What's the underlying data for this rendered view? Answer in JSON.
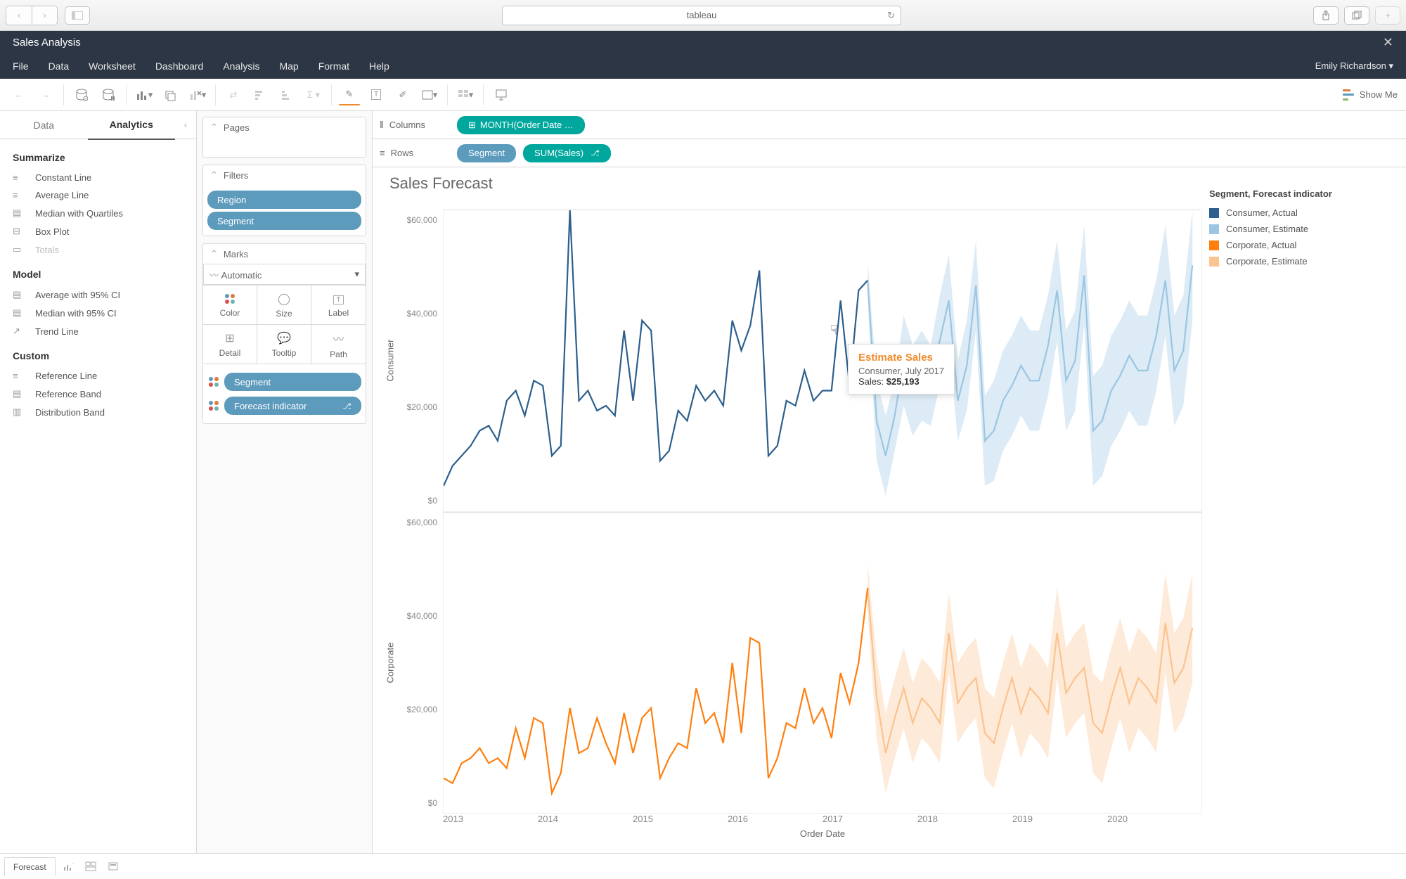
{
  "chrome": {
    "url": "tableau"
  },
  "header": {
    "title": "Sales Analysis",
    "menu": [
      "File",
      "Data",
      "Worksheet",
      "Dashboard",
      "Analysis",
      "Map",
      "Format",
      "Help"
    ],
    "user": "Emily Richardson ▾"
  },
  "toolbar": {
    "showme": "Show Me"
  },
  "left": {
    "tabs": [
      "Data",
      "Analytics"
    ],
    "summarize_h": "Summarize",
    "summarize": [
      "Constant Line",
      "Average Line",
      "Median with Quartiles",
      "Box Plot",
      "Totals"
    ],
    "model_h": "Model",
    "model": [
      "Average with 95% CI",
      "Median with 95% CI",
      "Trend Line"
    ],
    "custom_h": "Custom",
    "custom": [
      "Reference Line",
      "Reference Band",
      "Distribution Band"
    ]
  },
  "cards": {
    "pages": "Pages",
    "filters": "Filters",
    "filter_pills": [
      "Region",
      "Segment"
    ],
    "marks": "Marks",
    "mark_type": "Automatic",
    "mark_cells": [
      "Color",
      "Size",
      "Label",
      "Detail",
      "Tooltip",
      "Path"
    ],
    "mark_pills": [
      "Segment",
      "Forecast indicator"
    ]
  },
  "shelves": {
    "columns_lbl": "Columns",
    "columns_pill": "MONTH(Order Date …",
    "rows_lbl": "Rows",
    "rows_pills": [
      "Segment",
      "SUM(Sales)"
    ]
  },
  "viz": {
    "title": "Sales Forecast",
    "rows": [
      "Consumer",
      "Corporate"
    ],
    "yticks": [
      "$60,000",
      "$40,000",
      "$20,000",
      "$0"
    ],
    "xticks": [
      "2013",
      "2014",
      "2015",
      "2016",
      "2017",
      "2018",
      "2019",
      "2020"
    ],
    "xlabel": "Order Date",
    "legend_title": "Segment, Forecast indicator",
    "legend": [
      {
        "label": "Consumer, Actual",
        "color": "#2c5f8d"
      },
      {
        "label": "Consumer, Estimate",
        "color": "#9bc6e3"
      },
      {
        "label": "Corporate, Actual",
        "color": "#ff7f0e"
      },
      {
        "label": "Corporate, Estimate",
        "color": "#fbc38f"
      }
    ],
    "tooltip": {
      "title": "Estimate Sales",
      "sub": "Consumer, July 2017",
      "val_label": "Sales: ",
      "val": "$25,193"
    }
  },
  "footer": {
    "sheet": "Forecast"
  },
  "chart_data": {
    "type": "line",
    "xlabel": "Order Date",
    "ylabel": "Sales",
    "ylim": [
      0,
      60000
    ],
    "x_months": "2013-01 to 2020-01 monthly (85 months)",
    "actual_end_index": 48,
    "series": [
      {
        "name": "Consumer, Actual",
        "values": [
          5000,
          9000,
          11000,
          13000,
          16000,
          17000,
          14000,
          22000,
          24000,
          19000,
          26000,
          25000,
          11000,
          13000,
          60000,
          22000,
          24000,
          20000,
          21000,
          19000,
          36000,
          22000,
          38000,
          36000,
          10000,
          12000,
          20000,
          18000,
          25000,
          22000,
          24000,
          21000,
          38000,
          32000,
          37000,
          48000,
          11000,
          13000,
          22000,
          21000,
          28000,
          22000,
          24000,
          24000,
          42000,
          25000,
          44000,
          46000
        ]
      },
      {
        "name": "Consumer, Estimate",
        "values": [
          46000,
          18000,
          11000,
          19000,
          30000,
          24000,
          27000,
          25000,
          34000,
          42000,
          22000,
          29000,
          45000,
          14000,
          16000,
          22000,
          25000,
          29000,
          26000,
          26000,
          33000,
          44000,
          26000,
          30000,
          47000,
          16000,
          18000,
          24000,
          27000,
          31000,
          28000,
          28000,
          35000,
          46000,
          28000,
          32000,
          49000
        ],
        "ci_lower": [
          42000,
          10000,
          3000,
          12000,
          21000,
          15000,
          18000,
          17000,
          25000,
          33000,
          14000,
          20000,
          36000,
          5000,
          6000,
          12000,
          15000,
          19000,
          16000,
          16000,
          23000,
          34000,
          16000,
          20000,
          37000,
          5000,
          7000,
          13000,
          16000,
          20000,
          17000,
          17000,
          24000,
          35000,
          17000,
          21000,
          38000
        ],
        "ci_upper": [
          50000,
          26000,
          19000,
          26000,
          39000,
          33000,
          36000,
          33000,
          43000,
          51000,
          30000,
          38000,
          54000,
          23000,
          26000,
          32000,
          35000,
          39000,
          36000,
          36000,
          43000,
          54000,
          36000,
          40000,
          57000,
          27000,
          29000,
          35000,
          38000,
          42000,
          39000,
          39000,
          46000,
          57000,
          39000,
          43000,
          60000
        ]
      },
      {
        "name": "Corporate, Actual",
        "values": [
          7000,
          6000,
          10000,
          11000,
          13000,
          10000,
          11000,
          9000,
          17000,
          11000,
          19000,
          18000,
          4000,
          8000,
          21000,
          12000,
          13000,
          19000,
          14000,
          10000,
          20000,
          12000,
          19000,
          21000,
          7000,
          11000,
          14000,
          13000,
          25000,
          18000,
          20000,
          14000,
          30000,
          16000,
          35000,
          34000,
          7000,
          11000,
          18000,
          17000,
          25000,
          18000,
          21000,
          15000,
          28000,
          22000,
          30000,
          45000
        ]
      },
      {
        "name": "Corporate, Estimate",
        "values": [
          45000,
          23000,
          12000,
          19000,
          25000,
          18000,
          23000,
          21000,
          18000,
          36000,
          22000,
          25000,
          27000,
          16000,
          14000,
          21000,
          27000,
          20000,
          25000,
          23000,
          20000,
          36000,
          24000,
          27000,
          29000,
          18000,
          16000,
          23000,
          29000,
          22000,
          27000,
          25000,
          22000,
          38000,
          26000,
          29000,
          37000
        ],
        "ci_lower": [
          40000,
          15000,
          4000,
          11000,
          17000,
          10000,
          15000,
          13000,
          10000,
          28000,
          14000,
          17000,
          19000,
          7000,
          5000,
          12000,
          18000,
          11000,
          16000,
          14000,
          11000,
          27000,
          15000,
          18000,
          20000,
          8000,
          6000,
          13000,
          19000,
          12000,
          17000,
          15000,
          12000,
          28000,
          16000,
          19000,
          26000
        ],
        "ci_upper": [
          50000,
          31000,
          20000,
          27000,
          33000,
          26000,
          31000,
          29000,
          26000,
          44000,
          30000,
          33000,
          35000,
          25000,
          23000,
          30000,
          36000,
          29000,
          34000,
          32000,
          29000,
          45000,
          33000,
          36000,
          38000,
          28000,
          26000,
          33000,
          39000,
          32000,
          37000,
          35000,
          32000,
          48000,
          36000,
          39000,
          48000
        ]
      }
    ]
  }
}
